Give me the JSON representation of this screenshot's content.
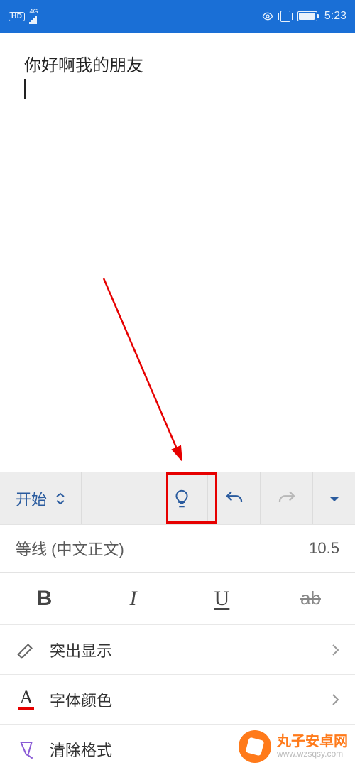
{
  "status": {
    "hd": "HD",
    "net": "4G",
    "time": "5:23"
  },
  "document": {
    "text": "你好啊我的朋友"
  },
  "toolbar": {
    "menu_label": "开始"
  },
  "font": {
    "name": "等线 (中文正文)",
    "size": "10.5"
  },
  "style_buttons": {
    "bold": "B",
    "italic": "I",
    "underline": "U",
    "strike": "ab"
  },
  "options": {
    "highlight": "突出显示",
    "font_color": "字体颜色",
    "font_color_glyph": "A",
    "clear_format": "清除格式"
  },
  "watermark": {
    "name": "丸子安卓网",
    "url": "www.wzsqsy.com"
  }
}
